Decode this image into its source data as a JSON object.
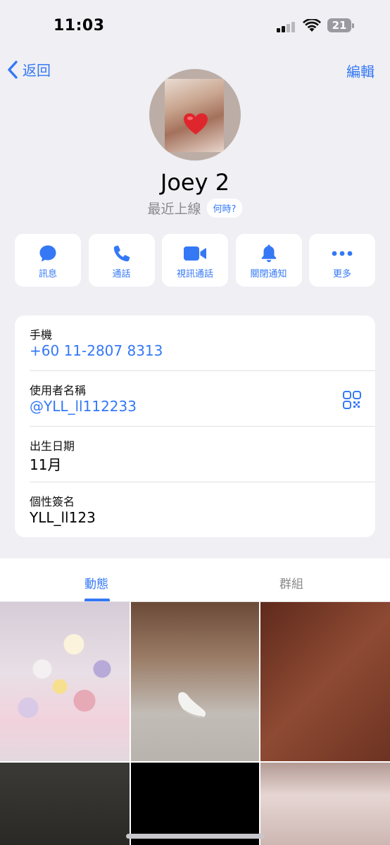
{
  "status_bar": {
    "time": "11:03",
    "battery": "21"
  },
  "nav": {
    "back_label": "返回",
    "edit_label": "編輯"
  },
  "profile": {
    "name": "Joey 2",
    "last_seen": "最近上線",
    "when_label": "何時?"
  },
  "actions": [
    {
      "label": "訊息",
      "icon": "message-icon"
    },
    {
      "label": "通話",
      "icon": "phone-icon"
    },
    {
      "label": "視訊通話",
      "icon": "video-icon"
    },
    {
      "label": "關閉通知",
      "icon": "bell-icon"
    },
    {
      "label": "更多",
      "icon": "more-icon"
    }
  ],
  "info": {
    "phone": {
      "label": "手機",
      "value": "+60 11-2807 8313"
    },
    "username": {
      "label": "使用者名稱",
      "value": "@YLL_ll112233"
    },
    "birthday": {
      "label": "出生日期",
      "value": "11月"
    },
    "bio": {
      "label": "個性簽名",
      "value": "YLL_ll123"
    }
  },
  "tabs": {
    "posts": "動態",
    "groups": "群組"
  },
  "colors": {
    "accent": "#3478f6",
    "background": "#efeff4",
    "secondary_text": "#8a8a8e"
  }
}
